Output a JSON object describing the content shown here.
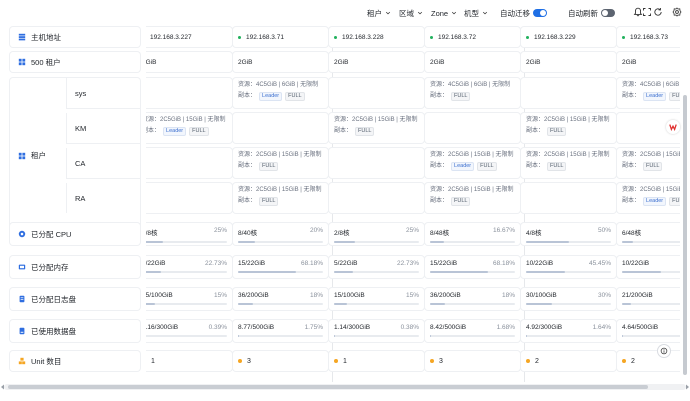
{
  "toolbar": {
    "filters": [
      {
        "label": "租户"
      },
      {
        "label": "区域"
      },
      {
        "label": "Zone"
      },
      {
        "label": "机型"
      }
    ],
    "auto_migrate_label": "自动迁移",
    "auto_migrate_on": true,
    "auto_refresh_label": "自动刷新",
    "auto_refresh_on": false,
    "accent_color": "#1f6fe5"
  },
  "row_labels": {
    "host_address": "主机地址",
    "tenant_count": "500 租户",
    "tenant": "租户",
    "tenant_subs": [
      "sys",
      "KM",
      "CA",
      "RA"
    ],
    "cpu": "已分配 CPU",
    "memory": "已分配内存",
    "log_disk": "已分配日志盘",
    "data_disk": "已使用数据盘",
    "unit_count": "Unit 数目"
  },
  "columns": [
    {
      "ip": "192.168.3.227",
      "dot_color": "#21b15d",
      "mem": "2GiB",
      "res": [
        null,
        {
          "line1": "资源：2C5GiB | 15GiB | 无限制",
          "role": "Leader",
          "repl": "FULL"
        },
        null,
        null
      ],
      "cpu": {
        "text": "2/8核",
        "pct": "25%",
        "ratio": 0.25
      },
      "memory": {
        "text": "5/22GiB",
        "pct": "22.73%",
        "ratio": 0.2273
      },
      "log": {
        "text": "15/100GiB",
        "pct": "15%",
        "ratio": 0.15
      },
      "data": {
        "text": "1.16/300GiB",
        "pct": "0.39%",
        "ratio": 0.0039
      },
      "units": "1",
      "unit_color": "#f5a623"
    },
    {
      "ip": "192.168.3.71",
      "dot_color": "#21b15d",
      "mem": "2GiB",
      "res": [
        {
          "line1": "资源：4C5GiB | 6GiB | 无限制",
          "role": "Leader",
          "repl": "FULL"
        },
        null,
        {
          "line1": "资源：2C5GiB | 15GiB | 无限制",
          "role": "",
          "repl": "FULL"
        },
        {
          "line1": "资源：2C5GiB | 15GiB | 无限制",
          "role": "",
          "repl": "FULL"
        }
      ],
      "cpu": {
        "text": "8/40核",
        "pct": "20%",
        "ratio": 0.2
      },
      "memory": {
        "text": "15/22GiB",
        "pct": "68.18%",
        "ratio": 0.6818
      },
      "log": {
        "text": "36/200GiB",
        "pct": "18%",
        "ratio": 0.18
      },
      "data": {
        "text": "8.77/500GiB",
        "pct": "1.75%",
        "ratio": 0.0175
      },
      "units": "3",
      "unit_color": "#f5a623"
    },
    {
      "ip": "192.168.3.228",
      "dot_color": "#21b15d",
      "mem": "2GiB",
      "res": [
        null,
        {
          "line1": "资源：2C5GiB | 15GiB | 无限制",
          "role": "",
          "repl": "FULL"
        },
        null,
        null
      ],
      "cpu": {
        "text": "2/8核",
        "pct": "25%",
        "ratio": 0.25
      },
      "memory": {
        "text": "5/22GiB",
        "pct": "22.73%",
        "ratio": 0.2273
      },
      "log": {
        "text": "15/100GiB",
        "pct": "15%",
        "ratio": 0.15
      },
      "data": {
        "text": "1.14/300GiB",
        "pct": "0.38%",
        "ratio": 0.0038
      },
      "units": "1",
      "unit_color": "#f5a623"
    },
    {
      "ip": "192.168.3.72",
      "dot_color": "#21b15d",
      "mem": "2GiB",
      "res": [
        {
          "line1": "资源：4C5GiB | 6GiB | 无限制",
          "role": "",
          "repl": "FULL"
        },
        null,
        {
          "line1": "资源：2C5GiB | 15GiB | 无限制",
          "role": "Leader",
          "repl": "FULL"
        },
        {
          "line1": "资源：2C5GiB | 15GiB | 无限制",
          "role": "",
          "repl": "FULL"
        }
      ],
      "cpu": {
        "text": "8/48核",
        "pct": "16.67%",
        "ratio": 0.1667
      },
      "memory": {
        "text": "15/22GiB",
        "pct": "68.18%",
        "ratio": 0.6818
      },
      "log": {
        "text": "36/200GiB",
        "pct": "18%",
        "ratio": 0.18
      },
      "data": {
        "text": "8.42/500GiB",
        "pct": "1.68%",
        "ratio": 0.0168
      },
      "units": "3",
      "unit_color": "#f5a623"
    },
    {
      "ip": "192.168.3.229",
      "dot_color": "#21b15d",
      "mem": "2GiB",
      "res": [
        null,
        {
          "line1": "资源：2C5GiB | 15GiB | 无限制",
          "role": "",
          "repl": "FULL"
        },
        {
          "line1": "资源：2C5GiB | 15GiB | 无限制",
          "role": "",
          "repl": "FULL"
        },
        null
      ],
      "cpu": {
        "text": "4/8核",
        "pct": "50%",
        "ratio": 0.5
      },
      "memory": {
        "text": "10/22GiB",
        "pct": "45.45%",
        "ratio": 0.4545
      },
      "log": {
        "text": "30/100GiB",
        "pct": "30%",
        "ratio": 0.3
      },
      "data": {
        "text": "4.92/300GiB",
        "pct": "1.64%",
        "ratio": 0.0164
      },
      "units": "2",
      "unit_color": "#f5a623"
    },
    {
      "ip": "192.168.3.73",
      "dot_color": "#21b15d",
      "mem": "2GiB",
      "res": [
        {
          "line1": "资源：4C5GiB | 6GiB | 无限制",
          "role": "Leader",
          "repl": "FULL"
        },
        null,
        {
          "line1": "资源：2C5GiB | 15GiB | 无限制",
          "role": "",
          "repl": "FULL"
        },
        {
          "line1": "资源：2C5GiB | 15GiB | 无限制",
          "role": "Leader",
          "repl": "FULL"
        }
      ],
      "cpu": {
        "text": "6/48核",
        "pct": "12.5%",
        "ratio": 0.125
      },
      "memory": {
        "text": "10/22GiB",
        "pct": "45.45%",
        "ratio": 0.4545
      },
      "log": {
        "text": "21/200GiB",
        "pct": "10.5%",
        "ratio": 0.105
      },
      "data": {
        "text": "4.64/500GiB",
        "pct": "0.93%",
        "ratio": 0.0093
      },
      "units": "2",
      "unit_color": "#f5a623"
    }
  ],
  "replica_label": "副本：",
  "icons": [
    "bell-icon",
    "expand-icon",
    "refresh-icon",
    "settings-icon",
    "help-icon"
  ]
}
